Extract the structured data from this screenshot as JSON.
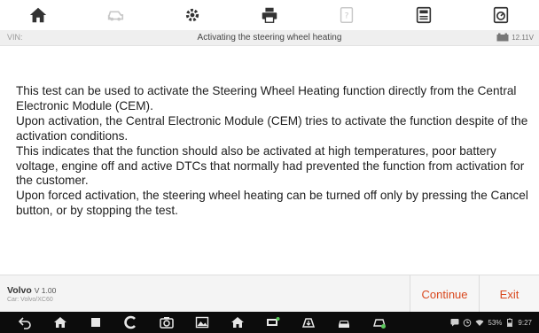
{
  "toolbar": {
    "items": [
      {
        "icon": "home-icon"
      },
      {
        "icon": "vehicle-icon"
      },
      {
        "icon": "settings-icon"
      },
      {
        "icon": "print-icon"
      },
      {
        "icon": "help-icon"
      },
      {
        "icon": "save-icon"
      },
      {
        "icon": "data-icon"
      }
    ]
  },
  "header": {
    "vin_label": "VIN:",
    "title": "Activating the steering wheel heating",
    "voltage": "12.11V"
  },
  "message": {
    "paragraphs": [
      "This test can be used to activate the Steering Wheel Heating function directly from the Central Electronic Module (CEM).",
      "Upon activation, the Central Electronic Module (CEM) tries to activate the function despite of the activation conditions.",
      "This indicates that the function should also be activated at high temperatures, poor battery voltage, engine off and active DTCs that normally had prevented the function from activation for the customer.",
      "Upon forced activation, the steering wheel heating can be turned off only by pressing the Cancel button, or by stopping the test."
    ]
  },
  "footer": {
    "brand": "Volvo",
    "version": "V 1.00",
    "car": "Car: Volvo/XC60",
    "continue_label": "Continue",
    "exit_label": "Exit"
  },
  "navbar": {
    "battery_percent": "53%",
    "time": "9:27"
  },
  "colors": {
    "accent": "#d9481e",
    "toolbar_icon": "#333333",
    "navbar_bg": "#0c0c0c"
  }
}
